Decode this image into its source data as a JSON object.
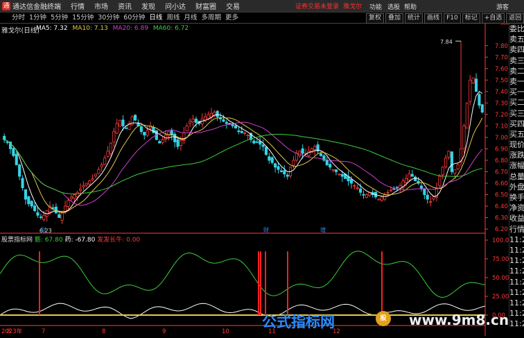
{
  "window": {
    "app_title": "通达信金融终端",
    "menus": [
      "行情",
      "市场",
      "资讯",
      "发现",
      "问小达",
      "财富圈",
      "交易"
    ],
    "alert": "证券交易未登录",
    "alert_stock": "雅戈尔",
    "right_menus": [
      "功能",
      "选股",
      "帮助",
      "游客"
    ]
  },
  "toolbar": {
    "periods": [
      "分时",
      "1分钟",
      "5分钟",
      "15分钟",
      "30分钟",
      "60分钟",
      "日线",
      "周线",
      "月线",
      "多周期",
      "更多"
    ],
    "active_period": "日线",
    "right_tools": [
      "复权",
      "叠加",
      "统计",
      "画线",
      "F10",
      "标记",
      "+自选",
      "返回"
    ]
  },
  "stock": {
    "name": "雅戈尔(日线)",
    "ma": [
      {
        "label": "MA5: 7.32",
        "color": "#ffffff"
      },
      {
        "label": "MA10: 7.13",
        "color": "#e6c84a"
      },
      {
        "label": "MA20: 6.89",
        "color": "#d040d0"
      },
      {
        "label": "MA60: 6.72",
        "color": "#3cd13c"
      }
    ]
  },
  "sidebar": {
    "labels": [
      "委比",
      "卖五",
      "卖四",
      "卖三",
      "卖二",
      "卖一",
      "买一",
      "买二",
      "买三",
      "买四",
      "买五",
      "现价",
      "涨跌",
      "涨幅",
      "总量",
      "外盘",
      "换手",
      "净资",
      "收益",
      "行情",
      "11:29",
      "11:29",
      "11:29",
      "11:29",
      "11:29",
      "11:29",
      "11:29",
      "11:29",
      "11:29"
    ]
  },
  "indicator": {
    "title": "股票指标网",
    "v1": "筋: 67.80",
    "v2": "药: -67.80",
    "v3": "发发长牛: 0.00"
  },
  "watermark": {
    "text1": "公式指标网",
    "text2": "www.9m8.cn",
    "logo_text": "股"
  },
  "colors": {
    "up": "#ff3b3b",
    "down": "#34d3e6",
    "ma5": "#ffffff",
    "ma10": "#e6c84a",
    "ma20": "#d040d0",
    "ma60": "#3cd13c",
    "axis": "#ff3b3b"
  },
  "chart_data": {
    "type": "candlestick",
    "yticks": [
      7.8,
      7.7,
      7.6,
      7.5,
      7.4,
      7.3,
      7.2,
      7.1,
      7.0,
      6.9,
      6.8,
      6.7,
      6.6,
      6.5,
      6.4,
      6.3,
      6.2
    ],
    "ylim": [
      6.17,
      7.92
    ],
    "high_marker": "7.84",
    "low_marker": "6.23",
    "top_tick": "500",
    "event_markers": [
      "财",
      "财",
      "增"
    ],
    "x_month_labels": [
      "8",
      "2023年",
      "7",
      "8",
      "9",
      "10",
      "11",
      "12"
    ],
    "ind_yticks": [
      "100.00",
      "75.00",
      "50.00",
      "25.00",
      "0.00"
    ],
    "closes": [
      6.98,
      6.96,
      6.9,
      6.84,
      6.76,
      6.66,
      6.56,
      6.46,
      6.42,
      6.4,
      6.36,
      6.32,
      6.3,
      6.32,
      6.36,
      6.4,
      6.38,
      6.34,
      6.3,
      6.34,
      6.4,
      6.45,
      6.48,
      6.5,
      6.52,
      6.55,
      6.58,
      6.6,
      6.62,
      6.64,
      6.68,
      6.72,
      6.76,
      6.82,
      6.88,
      6.95,
      7.05,
      7.12,
      7.15,
      7.1,
      7.08,
      7.12,
      7.18,
      7.15,
      7.1,
      7.05,
      7.02,
      7.06,
      7.1,
      7.04,
      6.98,
      6.95,
      6.98,
      7.02,
      7.05,
      7.02,
      6.96,
      6.92,
      6.97,
      7.04,
      7.1,
      7.14,
      7.16,
      7.13,
      7.12,
      7.16,
      7.18,
      7.2,
      7.21,
      7.22,
      7.18,
      7.16,
      7.14,
      7.12,
      7.12,
      7.1,
      7.08,
      7.05,
      7.04,
      7.04,
      7.02,
      6.98,
      6.95,
      6.96,
      6.94,
      6.92,
      6.85,
      6.8,
      6.78,
      6.74,
      6.72,
      6.7,
      6.68,
      6.66,
      6.74,
      6.8,
      6.86,
      6.88,
      6.86,
      6.86,
      6.88,
      6.9,
      6.92,
      6.88,
      6.84,
      6.8,
      6.76,
      6.74,
      6.72,
      6.7,
      6.68,
      6.66,
      6.64,
      6.62,
      6.6,
      6.58,
      6.56,
      6.52,
      6.5,
      6.5,
      6.52,
      6.5,
      6.48,
      6.46,
      6.48,
      6.5,
      6.52,
      6.54,
      6.55,
      6.56,
      6.58,
      6.62,
      6.64,
      6.68,
      6.66,
      6.62,
      6.6,
      6.55,
      6.5,
      6.46,
      6.44,
      6.48,
      6.56,
      6.66,
      6.74,
      6.82,
      6.88,
      6.7,
      6.72,
      6.76,
      6.9,
      7.1,
      7.3,
      7.5,
      7.52,
      7.4,
      7.28,
      7.22
    ],
    "highs_extra": {
      "150": 7.84
    },
    "ind_spikes": [
      57,
      373,
      376,
      383,
      415,
      551
    ]
  }
}
